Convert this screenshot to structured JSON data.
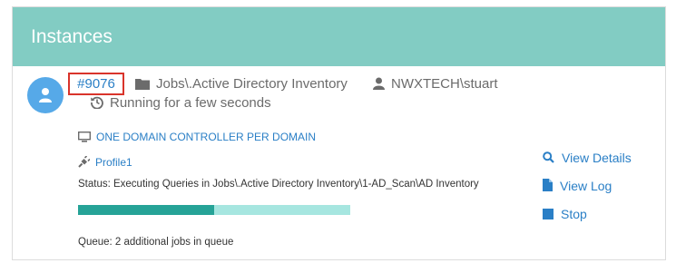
{
  "panel": {
    "title": "Instances"
  },
  "instance": {
    "id": "#9076",
    "job_path": "Jobs\\.Active Directory Inventory",
    "user": "NWXTECH\\stuart",
    "running_text": "Running for a few seconds",
    "policy": "ONE DOMAIN CONTROLLER PER DOMAIN",
    "profile": "Profile1",
    "status": "Status: Executing Queries in Jobs\\.Active Directory Inventory\\1-AD_Scan\\AD Inventory",
    "progress_fraction": 0.5,
    "queue": "Queue: 2 additional jobs in queue"
  },
  "actions": {
    "view_details": "View Details",
    "view_log": "View Log",
    "stop": "Stop"
  },
  "colors": {
    "header_bg": "#82ccc3",
    "accent_link": "#2a7fc6",
    "avatar": "#56a9e8",
    "progress_fill": "#26a397",
    "progress_track": "#a6e6e0",
    "highlight_border": "#d9342b"
  }
}
